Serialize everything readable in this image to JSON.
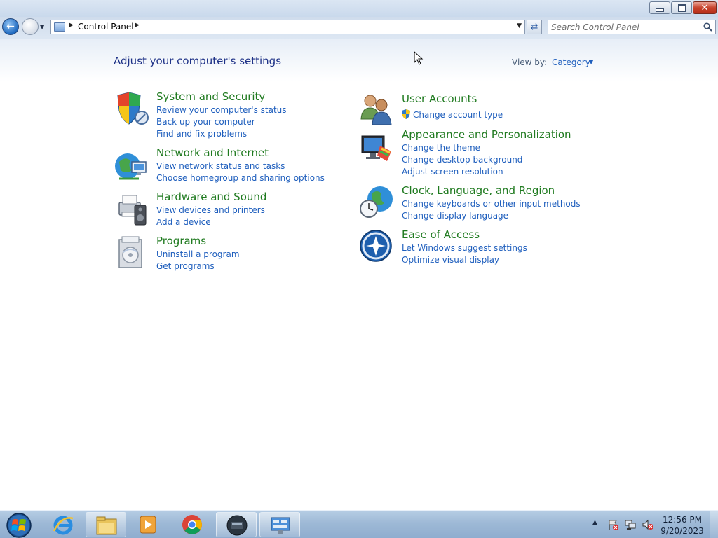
{
  "window": {
    "minimize_icon": "minimize-icon",
    "maximize_icon": "restore-icon",
    "close_icon": "close-icon"
  },
  "navigation": {
    "back_icon": "back-arrow-icon",
    "forward_icon": "forward-arrow-icon",
    "address_path": "Control Panel",
    "search_placeholder": "Search Control Panel"
  },
  "content": {
    "heading": "Adjust your computer's settings",
    "view_by_label": "View by:",
    "view_by_value": "Category"
  },
  "categories": [
    {
      "title": "System and Security",
      "icon": "shield-icon",
      "links": [
        "Review your computer's status",
        "Back up your computer",
        "Find and fix problems"
      ]
    },
    {
      "title": "Network and Internet",
      "icon": "network-globe-icon",
      "links": [
        "View network status and tasks",
        "Choose homegroup and sharing options"
      ]
    },
    {
      "title": "Hardware and Sound",
      "icon": "printer-speaker-icon",
      "links": [
        "View devices and printers",
        "Add a device"
      ]
    },
    {
      "title": "Programs",
      "icon": "programs-disc-icon",
      "links": [
        "Uninstall a program",
        "Get programs"
      ]
    },
    {
      "title": "User Accounts",
      "icon": "users-icon",
      "links": [
        "Change account type"
      ]
    },
    {
      "title": "Appearance and Personalization",
      "icon": "monitor-palette-icon",
      "links": [
        "Change the theme",
        "Change desktop background",
        "Adjust screen resolution"
      ]
    },
    {
      "title": "Clock, Language, and Region",
      "icon": "globe-clock-icon",
      "links": [
        "Change keyboards or other input methods",
        "Change display language"
      ]
    },
    {
      "title": "Ease of Access",
      "icon": "ease-of-access-icon",
      "links": [
        "Let Windows suggest settings",
        "Optimize visual display"
      ]
    }
  ],
  "taskbar": {
    "items": [
      "start-orb-icon",
      "internet-explorer-icon",
      "file-explorer-icon",
      "media-player-icon",
      "chrome-icon",
      "terminal-app-icon",
      "control-panel-icon"
    ],
    "tray_icons": [
      "show-hidden-icons-icon",
      "action-center-icon",
      "network-icon",
      "volume-muted-icon"
    ],
    "time": "12:56 PM",
    "date": "9/20/2023"
  }
}
